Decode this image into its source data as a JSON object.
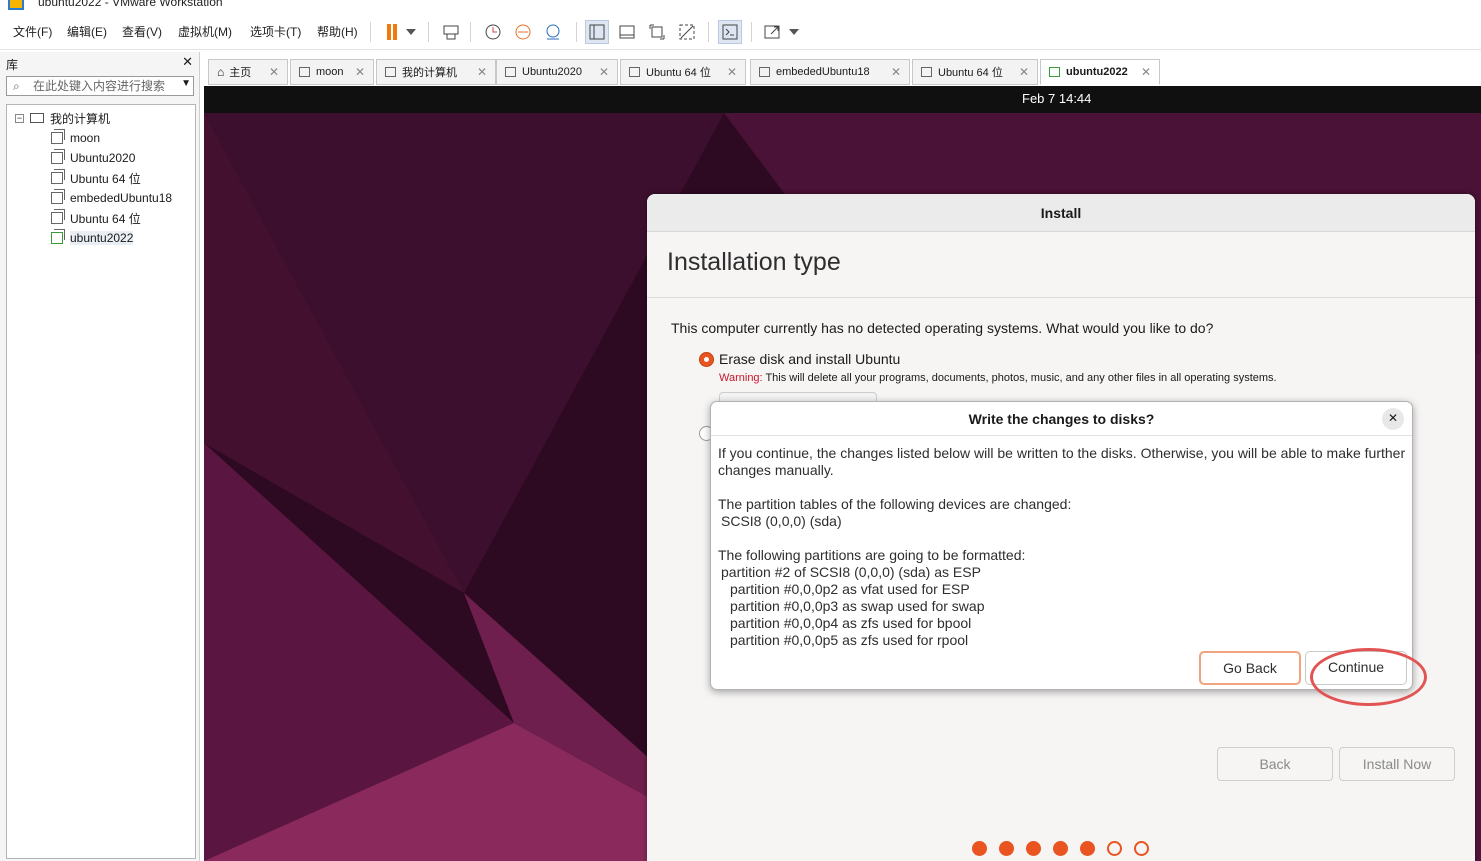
{
  "window": {
    "title": "ubuntu2022 - VMware Workstation"
  },
  "menubar": {
    "items": [
      "文件(F)",
      "编辑(E)",
      "查看(V)",
      "虚拟机(M)",
      "选项卡(T)",
      "帮助(H)"
    ]
  },
  "toolbar": {
    "icons": [
      "pause-icon",
      "dropdown-icon",
      "send-keys-icon",
      "snapshot-icon",
      "revert-snapshot-icon",
      "manage-snapshots-icon",
      "library-view-icon",
      "console-view-icon",
      "fullscreen-icon",
      "unity-icon",
      "terminal-icon",
      "stretch-icon"
    ],
    "accent": "#f07a10"
  },
  "library": {
    "title": "库",
    "close": "✕",
    "search_placeholder": "在此处键入内容进行搜索",
    "root": "我的计算机",
    "items": [
      "moon",
      "Ubuntu2020",
      "Ubuntu 64 位",
      "embededUbuntu18",
      "Ubuntu 64 位",
      "ubuntu2022"
    ],
    "selected": "ubuntu2022"
  },
  "tabs": [
    {
      "label": "主页",
      "icon": "home-icon"
    },
    {
      "label": "moon",
      "icon": "vm-icon"
    },
    {
      "label": "我的计算机",
      "icon": "computer-icon"
    },
    {
      "label": "Ubuntu2020",
      "icon": "vm-icon"
    },
    {
      "label": "Ubuntu 64 位",
      "icon": "vm-icon"
    },
    {
      "label": "embededUbuntu18",
      "icon": "vm-icon"
    },
    {
      "label": "Ubuntu 64 位",
      "icon": "vm-icon"
    },
    {
      "label": "ubuntu2022",
      "icon": "vm-running-icon",
      "active": true
    }
  ],
  "vm": {
    "clock": "Feb 7  14:44",
    "installer": {
      "window_title": "Install",
      "heading": "Installation type",
      "question": "This computer currently has no detected operating systems. What would you like to do?",
      "option1": "Erase disk and install Ubuntu",
      "warning_label": "Warning:",
      "warning_text": " This will delete all your programs, documents, photos, music, and any other files in all operating systems.",
      "back": "Back",
      "install_now": "Install Now",
      "progress": {
        "done": 5,
        "total": 7
      },
      "accent": "#e95420"
    },
    "dialog": {
      "title": "Write the changes to disks?",
      "close": "✕",
      "intro": "If you continue, the changes listed below will be written to the disks. Otherwise, you will be able to make further changes manually.",
      "tables_heading": "The partition tables of the following devices are changed:",
      "tables": [
        "SCSI8 (0,0,0) (sda)"
      ],
      "parts_heading": "The following partitions are going to be formatted:",
      "parts_main": "partition #2 of SCSI8 (0,0,0) (sda) as ESP",
      "parts": [
        "partition #0,0,0p2 as vfat used for ESP",
        "partition #0,0,0p3 as swap used for swap",
        "partition #0,0,0p4 as zfs used for bpool",
        "partition #0,0,0p5 as zfs used for rpool"
      ],
      "go_back": "Go Back",
      "continue": "Continue"
    }
  }
}
